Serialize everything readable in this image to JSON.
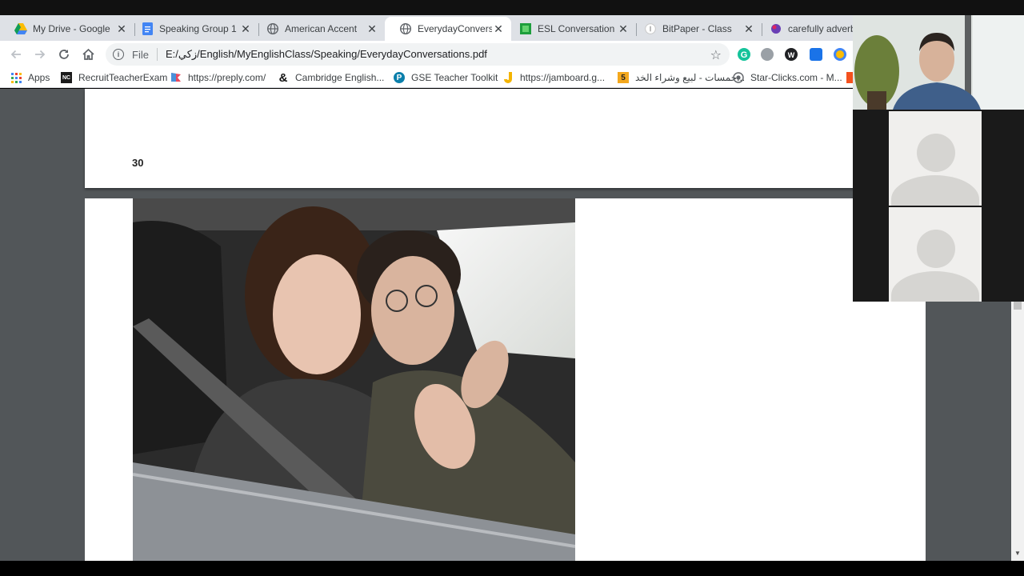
{
  "browser": {
    "tabs": [
      {
        "title": "My Drive - Google",
        "icon": "google-drive-icon",
        "active": false
      },
      {
        "title": "Speaking Group 1 |",
        "icon": "google-docs-icon",
        "active": false
      },
      {
        "title": "American Accent",
        "icon": "globe-icon",
        "active": false
      },
      {
        "title": "EverydayConversati",
        "icon": "globe-icon",
        "active": true
      },
      {
        "title": "ESL Conversation C",
        "icon": "green-square-icon",
        "active": false
      },
      {
        "title": "BitPaper - Class",
        "icon": "bitpaper-icon",
        "active": false
      },
      {
        "title": "carefully adverb",
        "icon": "purple-orb-icon",
        "active": false
      }
    ],
    "address": {
      "scheme": "File",
      "url": "E:/زكي/English/MyEnglishClass/Speaking/EverydayConversations.pdf"
    },
    "bookmarks": [
      {
        "label": "Apps",
        "icon": "apps-grid-icon"
      },
      {
        "label": "RecruitTeacherExam",
        "icon": "nc-icon",
        "icon_text": "NC"
      },
      {
        "label": "https://preply.com/",
        "icon": "flag-icon"
      },
      {
        "label": "Cambridge English...",
        "icon": "ampersand-icon",
        "icon_text": "&"
      },
      {
        "label": "GSE Teacher Toolkit",
        "icon": "pearson-icon",
        "icon_text": "P"
      },
      {
        "label": "https://jamboard.g...",
        "icon": "jamboard-icon"
      },
      {
        "label": "خمسات - لبيع وشراء الخد...",
        "icon": "khamsat-icon",
        "icon_text": "5"
      },
      {
        "label": "Star-Clicks.com - M...",
        "icon": "star-clicks-icon"
      }
    ]
  },
  "pdf": {
    "page_number": "30"
  },
  "colors": {
    "tabstrip": "#dee1e6",
    "viewer_bg": "#525659",
    "grammarly": "#15c39a"
  }
}
